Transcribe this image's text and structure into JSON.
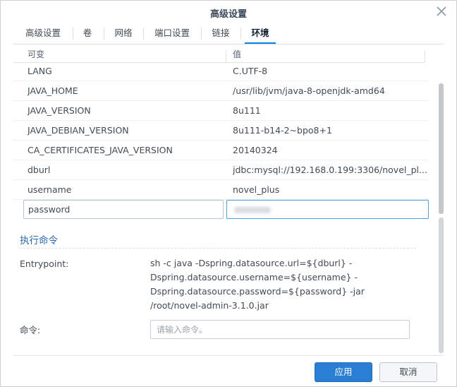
{
  "dialog": {
    "title": "高级设置"
  },
  "tabs": [
    {
      "label": "高级设置"
    },
    {
      "label": "卷"
    },
    {
      "label": "网络"
    },
    {
      "label": "端口设置"
    },
    {
      "label": "链接"
    },
    {
      "label": "环境",
      "active": true
    }
  ],
  "env_table": {
    "columns": [
      "可变",
      "值"
    ],
    "rows": [
      {
        "key": "LANG",
        "value": "C.UTF-8"
      },
      {
        "key": "JAVA_HOME",
        "value": "/usr/lib/jvm/java-8-openjdk-amd64"
      },
      {
        "key": "JAVA_VERSION",
        "value": "8u111"
      },
      {
        "key": "JAVA_DEBIAN_VERSION",
        "value": "8u111-b14-2~bpo8+1"
      },
      {
        "key": "CA_CERTIFICATES_JAVA_VERSION",
        "value": "20140324"
      },
      {
        "key": "dburl",
        "value": "jdbc:mysql://192.168.0.199:3306/novel_pl..."
      },
      {
        "key": "username",
        "value": "novel_plus"
      }
    ],
    "edit_row": {
      "key": "password"
    }
  },
  "exec": {
    "section_title": "执行命令",
    "entrypoint_label": "Entrypoint:",
    "entrypoint_lines": [
      "sh -c java -Dspring.datasource.url=${dburl} -",
      "Dspring.datasource.username=${username} -",
      "Dspring.datasource.password=${password} -jar",
      "/root/novel-admin-3.1.0.jar"
    ],
    "command_label": "命令:",
    "command_placeholder": "请输入命令。"
  },
  "footer": {
    "apply_label": "应用",
    "cancel_label": "取消"
  },
  "colors": {
    "accent": "#2a7fd4",
    "section": "#2a6ab0"
  },
  "icons": {
    "close": "close-icon"
  }
}
